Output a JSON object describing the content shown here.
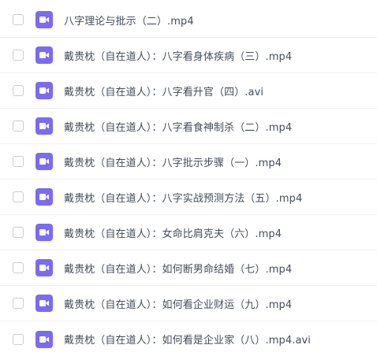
{
  "file_list": {
    "icon": "video-file-icon",
    "icon_color": "#7b6af2",
    "items": [
      {
        "name": "八字理论与批示（二）.mp4"
      },
      {
        "name": "戴贵枕（自在道人）：八字看身体疾病（三）.mp4"
      },
      {
        "name": "戴贵枕（自在道人）：八字看升官（四）.avi"
      },
      {
        "name": "戴贵枕（自在道人）：八字看食神制杀（二）.mp4"
      },
      {
        "name": "戴贵枕（自在道人）：八字批示步骤（一）.mp4"
      },
      {
        "name": "戴贵枕（自在道人）：八字实战预测方法（五）.mp4"
      },
      {
        "name": "戴贵枕（自在道人）：女命比肩克夫（六）.mp4"
      },
      {
        "name": "戴贵枕（自在道人）：如何断男命结婚（七）.mp4"
      },
      {
        "name": "戴贵枕（自在道人）：如何看企业财运（九）.mp4"
      },
      {
        "name": "戴贵枕（自在道人）：如何看是企业家（八）.mp4.avi"
      }
    ]
  }
}
